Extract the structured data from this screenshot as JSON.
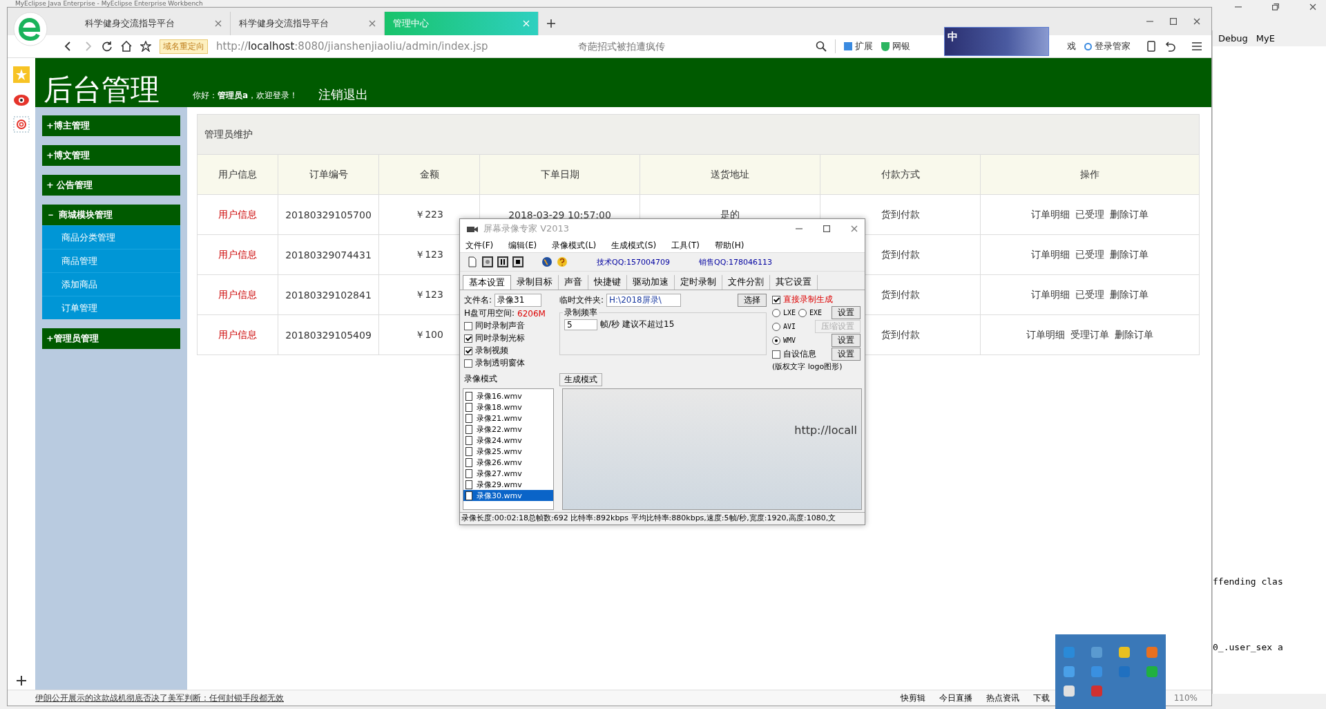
{
  "ide": {
    "title": "MyEclipse Java Enterprise - MyEclipse Enterprise Workbench",
    "perspectives": [
      "Debug",
      "MyE"
    ],
    "code_lines": [
      "ffending clas",
      "0_.user_sex a"
    ]
  },
  "browser": {
    "tabs": [
      {
        "label": "科学健身交流指导平台",
        "selected": false
      },
      {
        "label": "科学健身交流指导平台",
        "selected": false
      },
      {
        "label": "管理中心",
        "selected": true
      }
    ],
    "redirect_badge": "域名重定向",
    "url_dim": "http://",
    "url_host": "localhost",
    "url_rest": ":8080/jianshenjiaoliu/admin/index.jsp",
    "search_placeholder": "奇葩招式被拍遭疯传",
    "toolbar": [
      {
        "kind": "ext",
        "label": "扩展"
      },
      {
        "kind": "bank",
        "label": "网银"
      },
      {
        "kind": "game",
        "label": "戏"
      },
      {
        "kind": "login",
        "label": "登录管家"
      }
    ],
    "ime": {
      "label": "中"
    },
    "status": {
      "news": "伊朗公开展示的这款战机彻底否决了美军判断：任何封锁手段都无效",
      "items": [
        "快剪辑",
        "今日直播",
        "热点资讯",
        "下载"
      ],
      "zoom": "110%"
    }
  },
  "page": {
    "title": "后台管理",
    "greeting": "你好：**管理员a**，欢迎登录！",
    "logout": "注销退出",
    "sidebar": [
      {
        "label": "+博主管理"
      },
      {
        "label": "+博文管理"
      },
      {
        "label": "+ 公告管理"
      },
      {
        "label": "－ 商城模块管理",
        "children": [
          "商品分类管理",
          "商品管理",
          "添加商品",
          "订单管理"
        ]
      },
      {
        "label": "+管理员管理"
      }
    ],
    "panel_title": "管理员维护",
    "columns": [
      "用户信息",
      "订单编号",
      "金额",
      "下单日期",
      "送货地址",
      "付款方式",
      "操作"
    ],
    "rows": [
      {
        "user": "用户信息",
        "order": "20180329105700",
        "amount": "￥223",
        "date": "2018-03-29 10:57:00",
        "address": "是的",
        "payment": "货到付款",
        "actions": [
          "订单明细",
          "已受理",
          "删除订单"
        ]
      },
      {
        "user": "用户信息",
        "order": "20180329074431",
        "amount": "￥123",
        "payment": "货到付款",
        "actions": [
          "订单明细",
          "已受理",
          "删除订单"
        ]
      },
      {
        "user": "用户信息",
        "order": "20180329102841",
        "amount": "￥123",
        "payment": "货到付款",
        "actions": [
          "订单明细",
          "已受理",
          "删除订单"
        ]
      },
      {
        "user": "用户信息",
        "order": "20180329105409",
        "amount": "￥100",
        "payment": "货到付款",
        "actions": [
          "订单明细",
          "受理订单",
          "删除订单"
        ]
      }
    ]
  },
  "recorder": {
    "title": "屏幕录像专家 V2013",
    "menu": [
      "文件(F)",
      "编辑(E)",
      "录像模式(L)",
      "生成模式(S)",
      "工具(T)",
      "帮助(H)"
    ],
    "tech_qq": "技术QQ:157004709",
    "sales_qq": "销售QQ:178046113",
    "tabs": [
      {
        "label": "基本设置",
        "selected": true
      },
      {
        "label": "录制目标",
        "selected": false
      },
      {
        "label": "声音",
        "selected": false
      },
      {
        "label": "快捷键",
        "selected": false
      },
      {
        "label": "驱动加速",
        "selected": false
      },
      {
        "label": "定时录制",
        "selected": false
      },
      {
        "label": "文件分割",
        "selected": false
      },
      {
        "label": "其它设置",
        "selected": false
      }
    ],
    "filename_label": "文件名:",
    "filename": "录像31",
    "disk_label": "H盘可用空间:",
    "disk_value": "6206M",
    "options": [
      {
        "label": "同时录制声音",
        "checked": false
      },
      {
        "label": "同时录制光标",
        "checked": true
      },
      {
        "label": "录制视频",
        "checked": true
      },
      {
        "label": "录制透明窗体",
        "checked": false
      }
    ],
    "temp_label": "临时文件夹:",
    "temp_value": "H:\\2018屏录\\",
    "choose": "选择",
    "rate_label": "录制频率",
    "rate": "5",
    "rate_unit": "帧/秒",
    "rate_hint": "建议不超过15",
    "direct": {
      "label": "直接录制生成",
      "checked": true
    },
    "format_rows": [
      {
        "options": [
          {
            "label": "LXE",
            "selected": false
          },
          {
            "label": "EXE",
            "selected": false
          }
        ],
        "button": {
          "label": "设置",
          "disabled": false
        }
      },
      {
        "options": [
          {
            "label": "AVI",
            "selected": false
          }
        ],
        "button": {
          "label": "压缩设置",
          "disabled": true
        }
      },
      {
        "options": [
          {
            "label": "WMV",
            "selected": true
          }
        ],
        "button": {
          "label": "设置",
          "disabled": false
        }
      }
    ],
    "custom": {
      "label": "自设信息",
      "checked": false,
      "button": "设置",
      "note": "(版权文字 logo图形)"
    },
    "mode_label": "录像模式",
    "gen_label": "生成模式",
    "files": [
      {
        "name": "录像16.wmv",
        "selected": false
      },
      {
        "name": "录像18.wmv",
        "selected": false
      },
      {
        "name": "录像21.wmv",
        "selected": false
      },
      {
        "name": "录像22.wmv",
        "selected": false
      },
      {
        "name": "录像24.wmv",
        "selected": false
      },
      {
        "name": "录像25.wmv",
        "selected": false
      },
      {
        "name": "录像26.wmv",
        "selected": false
      },
      {
        "name": "录像27.wmv",
        "selected": false
      },
      {
        "name": "录像29.wmv",
        "selected": false
      },
      {
        "name": "录像30.wmv",
        "selected": true
      }
    ],
    "preview_url": "http://locall",
    "status": "录像长度:00:02:18总帧数:692 比特率:892kbps 平均比特率:880kbps,速度:5帧/秒,宽度:1920,高度:1080,文"
  }
}
